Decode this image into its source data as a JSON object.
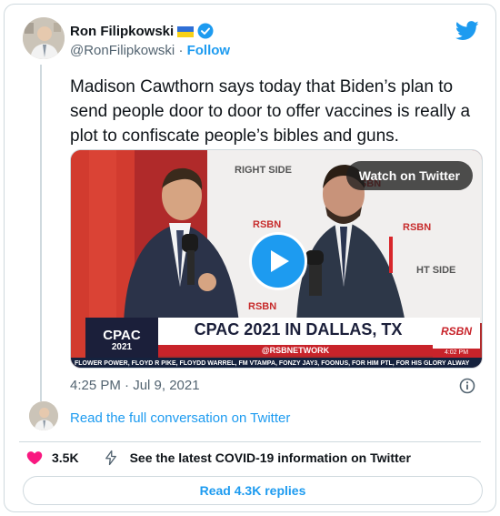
{
  "author": {
    "name": "Ron Filipkowski",
    "handle": "@RonFilipkowski",
    "separator": "·",
    "follow_label": "Follow"
  },
  "tweet": {
    "text": "Madison Cawthorn says today that Biden’s plan to send people door to door to offer vaccines is really a plot to confiscate people’s bibles and guns.",
    "timestamp": "4:25 PM · Jul 9, 2021"
  },
  "media": {
    "watch_label": "Watch on Twitter",
    "overlay": {
      "sign_top": "RIGHT SIDE",
      "banner_title": "CPAC 2021 IN DALLAS, TX",
      "banner_handle": "@RSBNETWORK",
      "logo_text": "CPAC",
      "logo_year": "2021",
      "rsbn": "RSBN",
      "time": "4:02 PM",
      "ticker": "FLOWER POWER, FLOYD R PIKE, FLOYDD WARREL, FM VTAMPA, FONZY JAY3, FOONUS, FOR HIM PTL, FOR HIS GLORY ALWAY"
    }
  },
  "conversation": {
    "read_full_label": "Read the full conversation on Twitter"
  },
  "stats": {
    "likes": "3.5K",
    "covid_label": "See the latest COVID-19 information on Twitter"
  },
  "replies": {
    "label": "Read 4.3K replies"
  },
  "colors": {
    "accent": "#1d9bf0",
    "heart": "#f91880",
    "text": "#0f1419",
    "muted": "#536471",
    "border": "#cfd9de"
  },
  "icons": {
    "twitter": "twitter-bird-icon",
    "verified": "verified-badge-icon",
    "flag": "ukraine-flag-icon",
    "play": "play-icon",
    "info": "info-icon",
    "heart": "heart-icon",
    "covid": "lightning-icon"
  }
}
